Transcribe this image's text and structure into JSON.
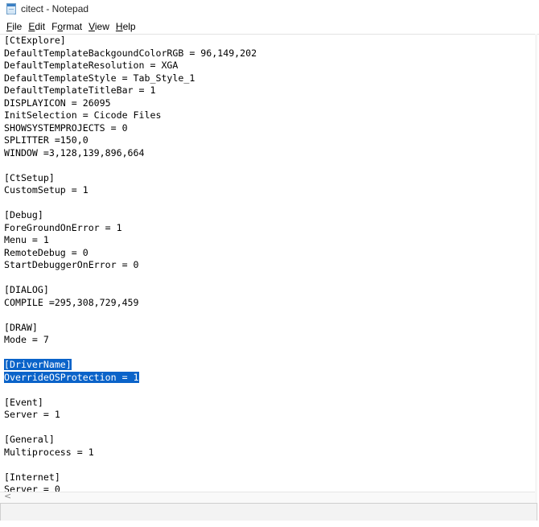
{
  "window": {
    "title": "citect - Notepad",
    "icon": "notepad-icon"
  },
  "menu": [
    {
      "pre": "",
      "acc": "F",
      "post": "ile"
    },
    {
      "pre": "",
      "acc": "E",
      "post": "dit"
    },
    {
      "pre": "F",
      "acc": "o",
      "post": "rmat"
    },
    {
      "pre": "",
      "acc": "V",
      "post": "iew"
    },
    {
      "pre": "",
      "acc": "H",
      "post": "elp"
    }
  ],
  "editor": {
    "lines": [
      "[CtExplore]",
      "DefaultTemplateBackgoundColorRGB = 96,149,202",
      "DefaultTemplateResolution = XGA",
      "DefaultTemplateStyle = Tab_Style_1",
      "DefaultTemplateTitleBar = 1",
      "DISPLAYICON = 26095",
      "InitSelection = Cicode Files",
      "SHOWSYSTEMPROJECTS = 0",
      "SPLITTER =150,0",
      "WINDOW =3,128,139,896,664",
      "",
      "[CtSetup]",
      "CustomSetup = 1",
      "",
      "[Debug]",
      "ForeGroundOnError = 1",
      "Menu = 1",
      "RemoteDebug = 0",
      "StartDebuggerOnError = 0",
      "",
      "[DIALOG]",
      "COMPILE =295,308,729,459",
      "",
      "[DRAW]",
      "Mode = 7",
      "",
      "[DriverName]",
      "OverrideOSProtection = 1",
      "",
      "[Event]",
      "Server = 1",
      "",
      "[General]",
      "Multiprocess = 1",
      "",
      "[Internet]",
      "Server = 0"
    ],
    "selected_lines": [
      26,
      27
    ]
  },
  "scrollbar": {
    "left_arrow": "<"
  }
}
